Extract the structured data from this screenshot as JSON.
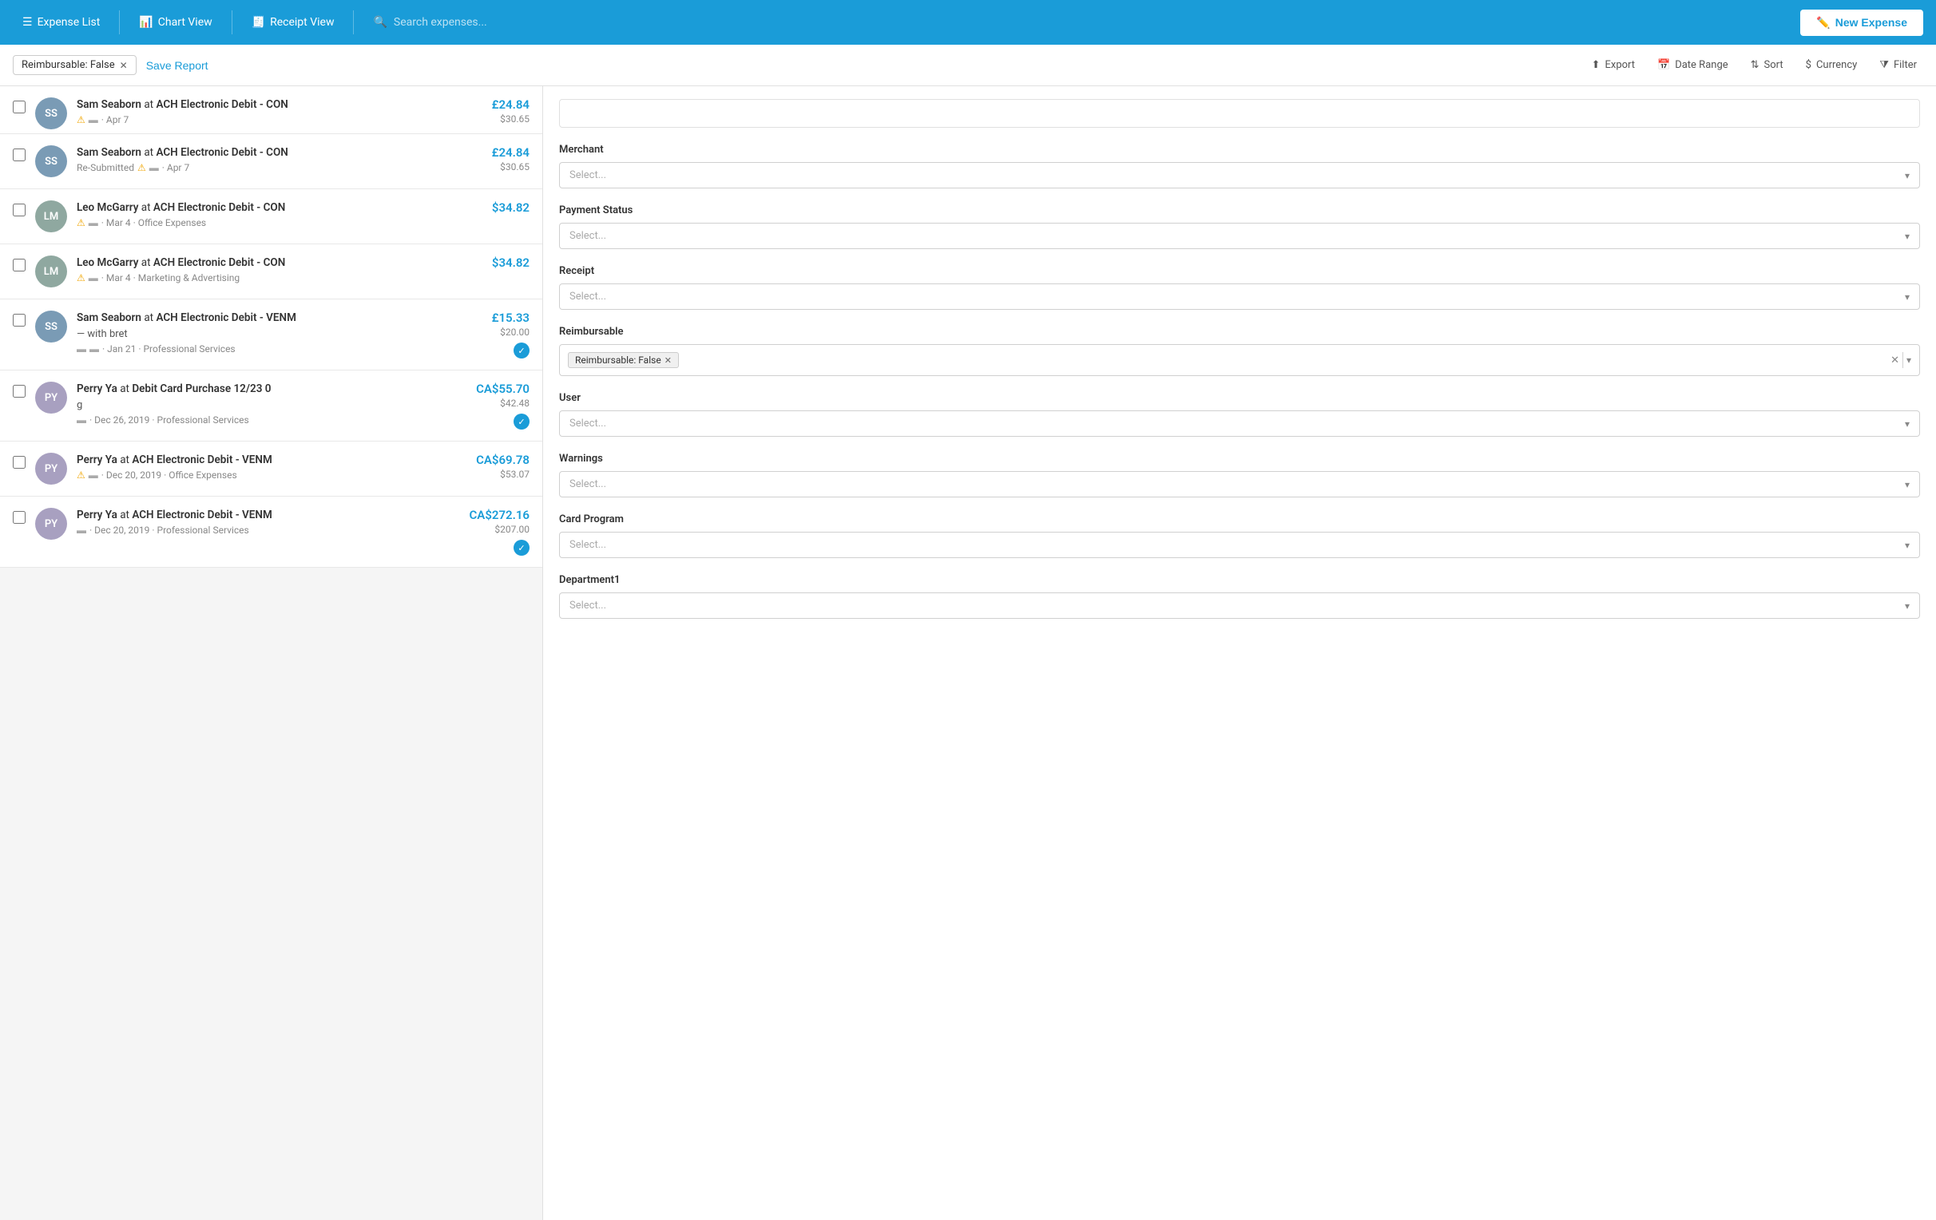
{
  "nav": {
    "expense_list_label": "Expense List",
    "chart_view_label": "Chart View",
    "receipt_view_label": "Receipt View",
    "search_placeholder": "Search expenses...",
    "new_expense_label": "New Expense"
  },
  "filter_bar": {
    "active_filter": "Reimbursable: False",
    "save_report_label": "Save Report",
    "export_label": "Export",
    "date_range_label": "Date Range",
    "sort_label": "Sort",
    "currency_label": "Currency",
    "filter_label": "Filter"
  },
  "expenses": [
    {
      "id": "1",
      "avatar_initials": "SS",
      "avatar_class": "ss",
      "title_person": "Sam Seaborn",
      "title_at": "at",
      "title_merchant": "ACH Electronic Debit - CON",
      "subtitle": "",
      "date": "Apr 7",
      "category": "",
      "amount_primary": "£24.84",
      "amount_secondary": "$30.65",
      "has_warning": true,
      "has_receipt": true,
      "has_check": false,
      "is_partial": true,
      "resubmitted": false
    },
    {
      "id": "2",
      "avatar_initials": "SS",
      "avatar_class": "ss",
      "title_person": "Sam Seaborn",
      "title_at": "at",
      "title_merchant": "ACH Electronic Debit - CON",
      "subtitle": "Re-Submitted",
      "date": "Apr 7",
      "category": "",
      "amount_primary": "£24.84",
      "amount_secondary": "$30.65",
      "has_warning": true,
      "has_receipt": true,
      "has_check": false,
      "is_partial": false,
      "resubmitted": true
    },
    {
      "id": "3",
      "avatar_initials": "LM",
      "avatar_class": "lm",
      "title_person": "Leo McGarry",
      "title_at": "at",
      "title_merchant": "ACH Electronic Debit - CON",
      "subtitle": "",
      "date": "Mar 4",
      "category": "Office Expenses",
      "amount_primary": "$34.82",
      "amount_secondary": "",
      "has_warning": true,
      "has_receipt": true,
      "has_check": false,
      "is_partial": false,
      "resubmitted": false
    },
    {
      "id": "4",
      "avatar_initials": "LM",
      "avatar_class": "lm",
      "title_person": "Leo McGarry",
      "title_at": "at",
      "title_merchant": "ACH Electronic Debit - CON",
      "subtitle": "",
      "date": "Mar 4",
      "category": "Marketing & Advertising",
      "amount_primary": "$34.82",
      "amount_secondary": "",
      "has_warning": true,
      "has_receipt": true,
      "has_check": false,
      "is_partial": false,
      "resubmitted": false
    },
    {
      "id": "5",
      "avatar_initials": "SS",
      "avatar_class": "ss",
      "title_person": "Sam Seaborn",
      "title_at": "at",
      "title_merchant": "ACH Electronic Debit - VENM",
      "subtitle_extra": "— with bret",
      "date": "Jan 21",
      "category": "Professional Services",
      "amount_primary": "£15.33",
      "amount_secondary": "$20.00",
      "has_warning": false,
      "has_receipt": true,
      "has_receipt2": true,
      "has_check": true,
      "is_partial": false,
      "resubmitted": false
    },
    {
      "id": "6",
      "avatar_initials": "PY",
      "avatar_class": "py",
      "title_person": "Perry Ya",
      "title_at": "at",
      "title_merchant": "Debit Card Purchase 12/23 0",
      "subtitle_extra": "g",
      "date": "Dec 26, 2019",
      "category": "Professional Services",
      "amount_primary": "CA$55.70",
      "amount_secondary": "$42.48",
      "has_warning": false,
      "has_receipt": true,
      "has_check": true,
      "is_partial": false,
      "resubmitted": false
    },
    {
      "id": "7",
      "avatar_initials": "PY",
      "avatar_class": "py",
      "title_person": "Perry Ya",
      "title_at": "at",
      "title_merchant": "ACH Electronic Debit - VENM",
      "subtitle": "",
      "date": "Dec 20, 2019",
      "category": "Office Expenses",
      "amount_primary": "CA$69.78",
      "amount_secondary": "$53.07",
      "has_warning": true,
      "has_receipt": true,
      "has_check": false,
      "is_partial": false,
      "resubmitted": false
    },
    {
      "id": "8",
      "avatar_initials": "PY",
      "avatar_class": "py",
      "title_person": "Perry Ya",
      "title_at": "at",
      "title_merchant": "ACH Electronic Debit - VENM",
      "subtitle": "",
      "date": "Dec 20, 2019",
      "category": "Professional Services",
      "amount_primary": "CA$272.16",
      "amount_secondary": "$207.00",
      "has_warning": false,
      "has_receipt": true,
      "has_check": true,
      "is_partial": false,
      "resubmitted": false
    }
  ],
  "filter_panel": {
    "merchant_label": "Merchant",
    "merchant_placeholder": "Select...",
    "payment_status_label": "Payment Status",
    "payment_status_placeholder": "Select...",
    "receipt_label": "Receipt",
    "receipt_placeholder": "Select...",
    "reimbursable_label": "Reimbursable",
    "reimbursable_value": "Reimbursable: False",
    "user_label": "User",
    "user_placeholder": "Select...",
    "warnings_label": "Warnings",
    "warnings_placeholder": "Select...",
    "card_program_label": "Card Program",
    "card_program_placeholder": "Select...",
    "department_label": "Department1",
    "department_placeholder": "Select..."
  }
}
